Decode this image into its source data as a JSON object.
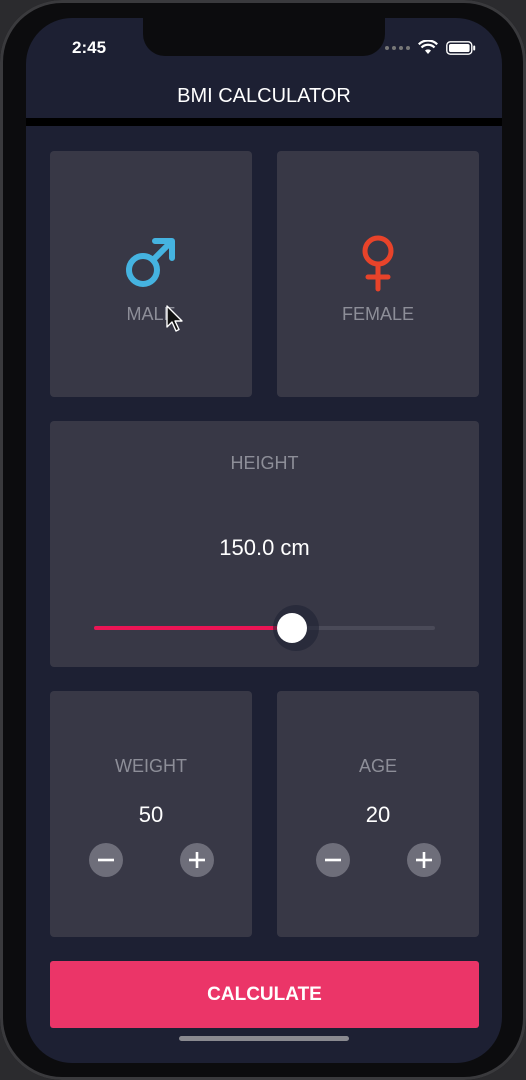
{
  "status_bar": {
    "time": "2:45"
  },
  "app_bar": {
    "title": "BMI CALCULATOR"
  },
  "gender": {
    "male_label": "MALE",
    "female_label": "FEMALE",
    "male_icon": "male-symbol-icon",
    "female_icon": "female-symbol-icon",
    "male_color": "#45b3e0",
    "female_color": "#e8432a"
  },
  "height": {
    "label": "HEIGHT",
    "value_text": "150.0 cm",
    "slider_fraction": 0.58
  },
  "weight": {
    "label": "WEIGHT",
    "value": "50"
  },
  "age": {
    "label": "AGE",
    "value": "20"
  },
  "calculate_label": "CALCULATE",
  "colors": {
    "background": "#1d2033",
    "card": "#383846",
    "accent": "#eb1555",
    "button": "#eb3568"
  }
}
